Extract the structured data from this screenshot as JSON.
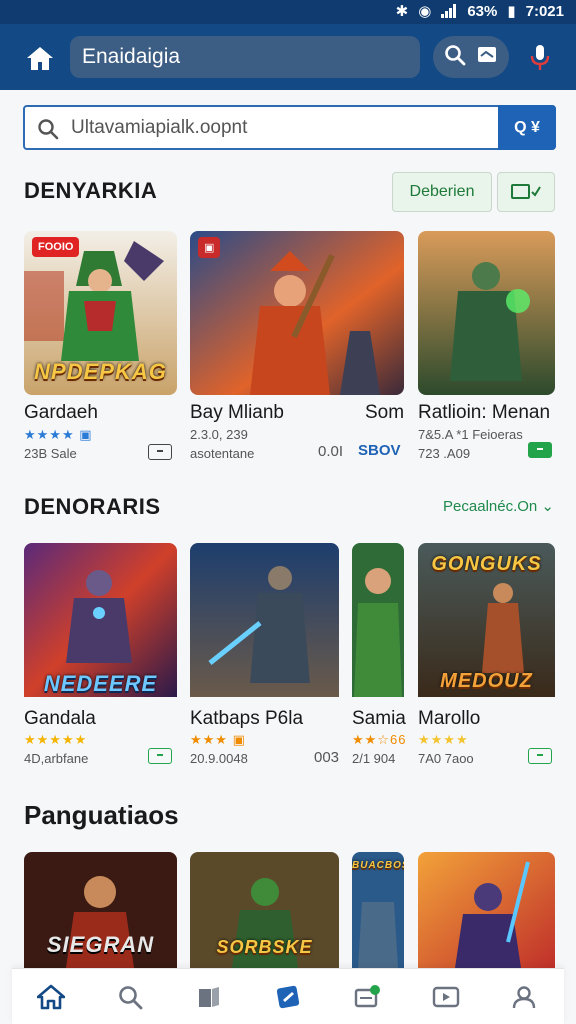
{
  "status": {
    "battery": "63%",
    "time": "7:021"
  },
  "appbar": {
    "title": "Enaidaigia"
  },
  "search": {
    "value": "Ultavamiapialk.oopnt",
    "submit_label": "Q ¥"
  },
  "section1": {
    "title": "DENYARKIA",
    "chip_label": "Deberien",
    "games": [
      {
        "title": "Gardaeh",
        "stars": "★★★★ ▣",
        "meta": "23B Sale",
        "badge": "FOOIO",
        "banner": "NPDEPKAG"
      },
      {
        "title": "Bay Mlianb",
        "meta": "2.3.0, 239",
        "meta2": "asotentane",
        "extra": "Som",
        "price": "0.0I",
        "price2": "SBOV"
      },
      {
        "title": "Ratlioin: Menan",
        "meta": "7&5.A *1 Feioeras",
        "meta2": "723 .A09"
      }
    ]
  },
  "section2": {
    "title": "DENORARIS",
    "see_more": "Pecaalnéc.On ⌄",
    "games": [
      {
        "title": "Gandala",
        "stars": "★★★★★",
        "meta": "4D,arbfane",
        "banner": "NEDEERE"
      },
      {
        "title": "Katbaps P6la",
        "stars": "★★★ ▣",
        "meta": "20.9.0048",
        "price": "003"
      },
      {
        "title": "Samia",
        "stars": "★★☆66",
        "meta": "2/1 904"
      },
      {
        "title": "Marollo",
        "stars": "★★★★",
        "meta": "7A0 7aoo",
        "banner": "GONGUKS",
        "banner2": "MEDOUZ"
      }
    ]
  },
  "section3": {
    "title": "Panguatiaos",
    "tiles": [
      {
        "banner": "SIEGRAN"
      },
      {
        "banner": "SORBSKE"
      },
      {
        "banner": "BUACBOS"
      },
      {
        "banner": ""
      }
    ]
  },
  "colors": {
    "appbar": "#134a86",
    "accent": "#1e63b5",
    "green": "#23a34a"
  },
  "nav": [
    "home-icon",
    "search-icon",
    "library-icon",
    "store-icon",
    "wallet-icon",
    "play-icon",
    "profile-icon"
  ]
}
